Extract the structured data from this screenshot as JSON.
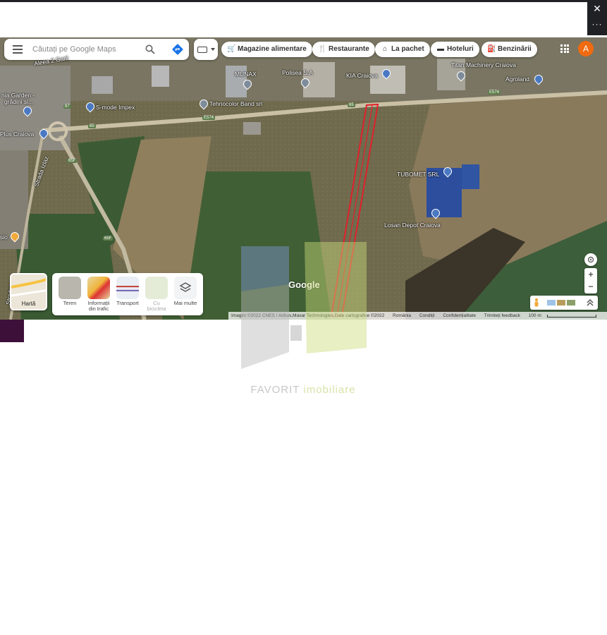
{
  "window": {
    "close_symbol": "✕",
    "more_symbol": "···"
  },
  "search": {
    "placeholder": "Căutați pe Google Maps"
  },
  "chips": [
    {
      "icon": "cart-icon",
      "glyph": "🛒",
      "label": "Magazine alimentare"
    },
    {
      "icon": "fork-knife-icon",
      "glyph": "🍴",
      "label": "Restaurante"
    },
    {
      "icon": "takeout-icon",
      "glyph": "⌂",
      "label": "La pachet"
    },
    {
      "icon": "bed-icon",
      "glyph": "▬",
      "label": "Hoteluri"
    },
    {
      "icon": "fuel-icon",
      "glyph": "⛽",
      "label": "Benzinării"
    }
  ],
  "account": {
    "initial": "A",
    "color": "#f06a0f"
  },
  "map": {
    "pois": [
      {
        "label": "MUNAX"
      },
      {
        "label": "Polisea S.A"
      },
      {
        "label": "KIA Craiova"
      },
      {
        "label": "Titan Machinery Craiova"
      },
      {
        "label": "Agroland"
      },
      {
        "label": "Tehnocolor Band srl"
      },
      {
        "label": "S-mode Impex"
      },
      {
        "label": "TUBOMET SRL"
      },
      {
        "label": "Losan Depot Craiova"
      },
      {
        "label": "nia Garden -"
      },
      {
        "label": "grădini și..."
      },
      {
        "label": "Plus Craiova"
      },
      {
        "label": "Strada Izlaz"
      },
      {
        "label": "Strada I."
      },
      {
        "label": "Aleea 2 Garii"
      },
      {
        "label": "sio"
      }
    ],
    "roads": [
      "E574",
      "E574",
      "65",
      "65",
      "65F",
      "65F",
      "87"
    ]
  },
  "layers": {
    "current": "Hartă",
    "items": [
      {
        "label": "Teren",
        "disabled": false
      },
      {
        "label": "Informații din trafic",
        "disabled": false
      },
      {
        "label": "Transport",
        "disabled": false
      },
      {
        "label": "Cu bicicleta",
        "disabled": true
      },
      {
        "label": "Mai multe",
        "disabled": false
      }
    ]
  },
  "controls": {
    "zoom_in": "+",
    "zoom_out": "−"
  },
  "footer": {
    "logo": "Google",
    "imagery": "Imagini ©2022 CNES / Airbus,Maxar Technologies,Date cartografice ©2022",
    "country": "România",
    "terms": "Condiții",
    "privacy": "Confidențialitate",
    "feedback": "Trimiteți feedback",
    "scale": "100 m"
  },
  "watermark": {
    "word1": "FAVORIT",
    "word2": "imobiliare"
  }
}
